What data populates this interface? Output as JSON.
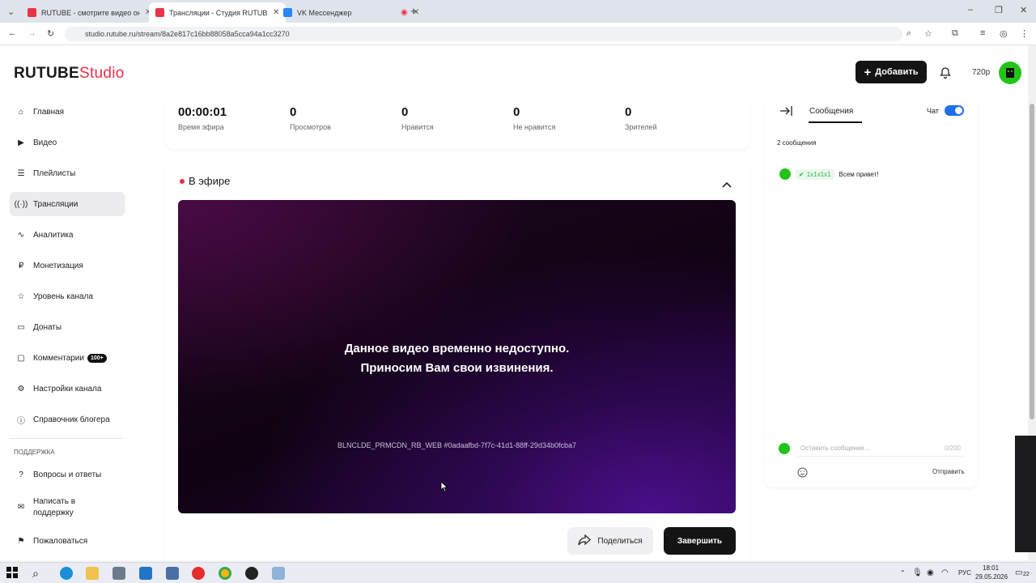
{
  "browser": {
    "tabs": [
      {
        "title": "RUTUBE - смотрите видео онл",
        "color": "#e8334a",
        "active": false
      },
      {
        "title": "Трансляции - Студия RUTUBE",
        "color": "#e8334a",
        "active": true
      },
      {
        "title": "VK Мессенджер",
        "color": "#2787f5",
        "active": false
      }
    ],
    "url": "studio.rutube.ru/stream/8a2e817c16bb88058a5cca94a1cc3270",
    "new_tab_label": "+"
  },
  "header": {
    "logo_main": "RUTUBE",
    "logo_sub": "Studio",
    "add_label": "Добавить",
    "resolution": "720p"
  },
  "sidebar": {
    "items": [
      {
        "label": "Главная",
        "icon": "home-icon"
      },
      {
        "label": "Видео",
        "icon": "video-icon"
      },
      {
        "label": "Плейлисты",
        "icon": "playlist-icon"
      },
      {
        "label": "Трансляции",
        "icon": "broadcast-icon"
      },
      {
        "label": "Аналитика",
        "icon": "analytics-icon"
      },
      {
        "label": "Монетизация",
        "icon": "ruble-icon"
      },
      {
        "label": "Уровень канала",
        "icon": "star-icon"
      },
      {
        "label": "Донаты",
        "icon": "donate-icon"
      },
      {
        "label": "Комментарии",
        "icon": "comment-icon"
      },
      {
        "label": "Настройки канала",
        "icon": "settings-icon"
      },
      {
        "label": "Справочник блогера",
        "icon": "info-icon"
      }
    ],
    "comments_badge": "100+",
    "support_section": "ПОДДЕРЖКА",
    "support_items": [
      {
        "label": "Вопросы и ответы",
        "icon": "question-icon"
      },
      {
        "label": "Написать в поддержку",
        "icon": "mail-icon"
      },
      {
        "label": "Пожаловаться",
        "icon": "flag-icon"
      }
    ]
  },
  "stats": [
    {
      "value": "00:00:01",
      "label": "Время эфира"
    },
    {
      "value": "0",
      "label": "Просмотров"
    },
    {
      "value": "0",
      "label": "Нравится"
    },
    {
      "value": "0",
      "label": "Не нравится"
    },
    {
      "value": "0",
      "label": "Зрителей"
    }
  ],
  "live": {
    "title": "В эфире",
    "message_line1": "Данное видео временно недоступно.",
    "message_line2": "Приносим Вам свои извинения.",
    "error_code": "BLNCLDE_PRMCDN_RB_WEB #0adaafbd-7f7c-41d1-88ff-29d34b0fcba7",
    "share_label": "Поделиться",
    "finish_label": "Завершить"
  },
  "chat": {
    "tab_label": "Сообщения",
    "chat_toggle_label": "Чат",
    "chat_enabled": true,
    "message_count": "2 сообщения",
    "messages": [
      {
        "author": "1x1x1x1",
        "text": "Всем привет!"
      }
    ],
    "input_placeholder": "Оставить сообщение...",
    "input_counter": "0/200",
    "send_label": "Отправить"
  },
  "taskbar": {
    "lang": "РУС",
    "time": "18:01",
    "date": "29.05.2026",
    "notification_count": "22"
  },
  "colors": {
    "accent": "#ee2e4a",
    "primary_button": "#141414",
    "toggle": "#1d6ee8"
  }
}
